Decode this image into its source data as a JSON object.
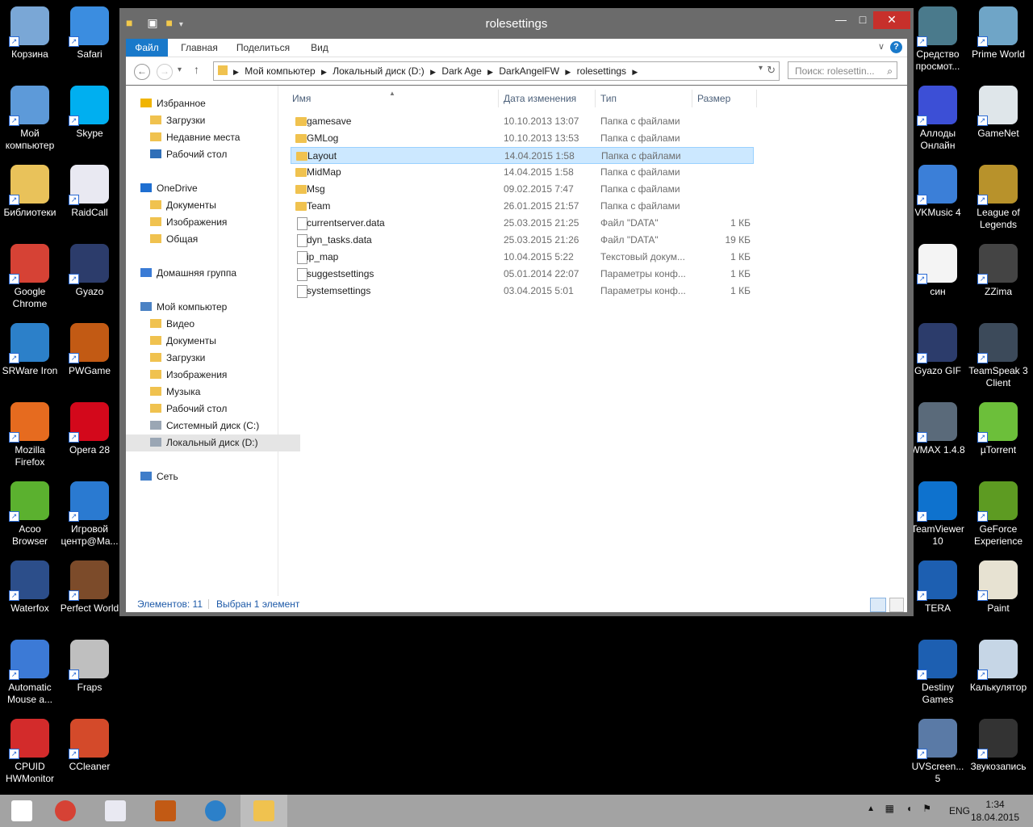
{
  "desktop_left": [
    {
      "label": "Корзина",
      "icon": "recycle-bin-icon",
      "color": "#7aa7d6"
    },
    {
      "label": "Safari",
      "icon": "safari-icon",
      "color": "#3b8de0"
    },
    {
      "label": "Мой компьютер",
      "icon": "computer-icon",
      "color": "#5d9ad9"
    },
    {
      "label": "Skype",
      "icon": "skype-icon",
      "color": "#00aff0"
    },
    {
      "label": "Библиотеки",
      "icon": "libraries-icon",
      "color": "#e9c25a"
    },
    {
      "label": "RaidCall",
      "icon": "raidcall-icon",
      "color": "#e9e9f2"
    },
    {
      "label": "Google Chrome",
      "icon": "chrome-icon",
      "color": "#d64235"
    },
    {
      "label": "Gyazo",
      "icon": "gyazo-icon",
      "color": "#2c3c6b"
    },
    {
      "label": "SRWare Iron",
      "icon": "srware-iron-icon",
      "color": "#2c80c9"
    },
    {
      "label": "PWGame",
      "icon": "pwgame-icon",
      "color": "#c25a14"
    },
    {
      "label": "Mozilla Firefox",
      "icon": "firefox-icon",
      "color": "#e66b1f"
    },
    {
      "label": "Opera 28",
      "icon": "opera-icon",
      "color": "#d3081b"
    },
    {
      "label": "Acoo Browser",
      "icon": "acoo-browser-icon",
      "color": "#5bb12f"
    },
    {
      "label": "Игровой центр@Ma...",
      "icon": "game-center-icon",
      "color": "#2a7ad1"
    },
    {
      "label": "Waterfox",
      "icon": "waterfox-icon",
      "color": "#2c4e8a"
    },
    {
      "label": "Perfect World",
      "icon": "perfect-world-icon",
      "color": "#7c4b2a"
    },
    {
      "label": "Automatic Mouse a...",
      "icon": "auto-mouse-icon",
      "color": "#3c7ad6"
    },
    {
      "label": "Fraps",
      "icon": "fraps-icon",
      "color": "#bfbfbf"
    },
    {
      "label": "CPUID HWMonitor",
      "icon": "hwmonitor-icon",
      "color": "#d32b2b"
    },
    {
      "label": "CCleaner",
      "icon": "ccleaner-icon",
      "color": "#d44a2a"
    }
  ],
  "desktop_right": [
    {
      "label": "Средство просмот...",
      "icon": "viewer-icon",
      "color": "#4a7a8c"
    },
    {
      "label": "Prime World",
      "icon": "prime-world-icon",
      "color": "#6fa5c7"
    },
    {
      "label": "Аллоды Онлайн",
      "icon": "allods-icon",
      "color": "#3c4fd6"
    },
    {
      "label": "GameNet",
      "icon": "gamenet-icon",
      "color": "#dfe6ea"
    },
    {
      "label": "VKMusic 4",
      "icon": "vkmusic-icon",
      "color": "#3b7fd8"
    },
    {
      "label": "League of Legends",
      "icon": "lol-icon",
      "color": "#b8922b"
    },
    {
      "label": "син",
      "icon": "text-file-icon",
      "color": "#f4f4f4"
    },
    {
      "label": "ZZima",
      "icon": "zzima-icon",
      "color": "#444444"
    },
    {
      "label": "Gyazo GIF",
      "icon": "gyazo-gif-icon",
      "color": "#2c3c6b"
    },
    {
      "label": "TeamSpeak 3 Client",
      "icon": "teamspeak-icon",
      "color": "#3c4a5a"
    },
    {
      "label": "WMAX 1.4.8",
      "icon": "wmax-icon",
      "color": "#5a6a7a"
    },
    {
      "label": "µTorrent",
      "icon": "utorrent-icon",
      "color": "#6cbf3a"
    },
    {
      "label": "TeamViewer 10",
      "icon": "teamviewer-icon",
      "color": "#0e72ce"
    },
    {
      "label": "GeForce Experience",
      "icon": "geforce-icon",
      "color": "#5d9b22"
    },
    {
      "label": "TERA",
      "icon": "tera-icon",
      "color": "#1d5fb1"
    },
    {
      "label": "Paint",
      "icon": "paint-icon",
      "color": "#e7e2d2"
    },
    {
      "label": "Destiny Games",
      "icon": "destiny-games-icon",
      "color": "#1d5fb1"
    },
    {
      "label": "Калькулятор",
      "icon": "calculator-icon",
      "color": "#c6d6e6"
    },
    {
      "label": "UVScreen... 5",
      "icon": "uvscreen-icon",
      "color": "#5a7aa6"
    },
    {
      "label": "Звукозапись",
      "icon": "sound-recorder-icon",
      "color": "#333333"
    }
  ],
  "window": {
    "title": "rolesettings",
    "minimize": "—",
    "maximize": "□",
    "close": "✕",
    "ribbon_tabs": [
      "Файл",
      "Главная",
      "Поделиться",
      "Вид"
    ],
    "help": "?",
    "collapse": "∨",
    "nav": {
      "back": "←",
      "forward": "→",
      "recent": "▾",
      "up": "↑"
    },
    "breadcrumbs": [
      "Мой компьютер",
      "Локальный диск (D:)",
      "Dark Age",
      "DarkAngelFW",
      "rolesettings"
    ],
    "refresh": "↻",
    "search_placeholder": "Поиск: rolesettin...",
    "search_icon": "⌕",
    "navpane": [
      {
        "label": "Избранное",
        "icon": "star-icon",
        "indent": 0
      },
      {
        "label": "Загрузки",
        "icon": "downloads-icon",
        "indent": 1
      },
      {
        "label": "Недавние места",
        "icon": "recent-places-icon",
        "indent": 1
      },
      {
        "label": "Рабочий стол",
        "icon": "desktop-icon",
        "indent": 1
      },
      {
        "label": "OneDrive",
        "icon": "onedrive-icon",
        "indent": 0,
        "gap": true
      },
      {
        "label": "Документы",
        "icon": "folder-icon",
        "indent": 1
      },
      {
        "label": "Изображения",
        "icon": "folder-icon",
        "indent": 1
      },
      {
        "label": "Общая",
        "icon": "folder-icon",
        "indent": 1
      },
      {
        "label": "Домашняя группа",
        "icon": "homegroup-icon",
        "indent": 0,
        "gap": true
      },
      {
        "label": "Мой компьютер",
        "icon": "computer-icon",
        "indent": 0,
        "gap": true
      },
      {
        "label": "Видео",
        "icon": "folder-icon",
        "indent": 1
      },
      {
        "label": "Документы",
        "icon": "folder-icon",
        "indent": 1
      },
      {
        "label": "Загрузки",
        "icon": "folder-icon",
        "indent": 1
      },
      {
        "label": "Изображения",
        "icon": "folder-icon",
        "indent": 1
      },
      {
        "label": "Музыка",
        "icon": "folder-icon",
        "indent": 1
      },
      {
        "label": "Рабочий стол",
        "icon": "folder-icon",
        "indent": 1
      },
      {
        "label": "Системный диск (C:)",
        "icon": "drive-icon",
        "indent": 1
      },
      {
        "label": "Локальный диск (D:)",
        "icon": "drive-icon",
        "indent": 1,
        "selected": true
      },
      {
        "label": "Сеть",
        "icon": "network-icon",
        "indent": 0,
        "gap": true
      }
    ],
    "columns": [
      "Имя",
      "Дата изменения",
      "Тип",
      "Размер"
    ],
    "files": [
      {
        "name": "gamesave",
        "date": "10.10.2013 13:07",
        "type": "Папка с файлами",
        "size": "",
        "kind": "folder"
      },
      {
        "name": "GMLog",
        "date": "10.10.2013 13:53",
        "type": "Папка с файлами",
        "size": "",
        "kind": "folder"
      },
      {
        "name": "Layout",
        "date": "14.04.2015 1:58",
        "type": "Папка с файлами",
        "size": "",
        "kind": "folder",
        "selected": true
      },
      {
        "name": "MidMap",
        "date": "14.04.2015 1:58",
        "type": "Папка с файлами",
        "size": "",
        "kind": "folder"
      },
      {
        "name": "Msg",
        "date": "09.02.2015 7:47",
        "type": "Папка с файлами",
        "size": "",
        "kind": "folder"
      },
      {
        "name": "Team",
        "date": "26.01.2015 21:57",
        "type": "Папка с файлами",
        "size": "",
        "kind": "folder"
      },
      {
        "name": "currentserver.data",
        "date": "25.03.2015 21:25",
        "type": "Файл \"DATA\"",
        "size": "1 КБ",
        "kind": "file"
      },
      {
        "name": "dyn_tasks.data",
        "date": "25.03.2015 21:26",
        "type": "Файл \"DATA\"",
        "size": "19 КБ",
        "kind": "file"
      },
      {
        "name": "ip_map",
        "date": "10.04.2015 5:22",
        "type": "Текстовый докум...",
        "size": "1 КБ",
        "kind": "file"
      },
      {
        "name": "suggestsettings",
        "date": "05.01.2014 22:07",
        "type": "Параметры конф...",
        "size": "1 КБ",
        "kind": "cfg"
      },
      {
        "name": "systemsettings",
        "date": "03.04.2015 5:01",
        "type": "Параметры конф...",
        "size": "1 КБ",
        "kind": "cfg"
      }
    ],
    "status": {
      "count": "Элементов: 11",
      "selected": "Выбран 1 элемент"
    }
  },
  "taskbar": {
    "apps": [
      {
        "icon": "start-icon",
        "color": "#ffffff"
      },
      {
        "icon": "chrome-icon",
        "color": "#d64235"
      },
      {
        "icon": "raidcall-icon",
        "color": "#e9e9f2"
      },
      {
        "icon": "pwgame-icon",
        "color": "#c25a14"
      },
      {
        "icon": "srware-iron-icon",
        "color": "#2c80c9"
      },
      {
        "icon": "file-explorer-icon",
        "color": "#f0c24f"
      }
    ],
    "lang": "ENG",
    "time": "1:34",
    "date": "18.04.2015"
  }
}
